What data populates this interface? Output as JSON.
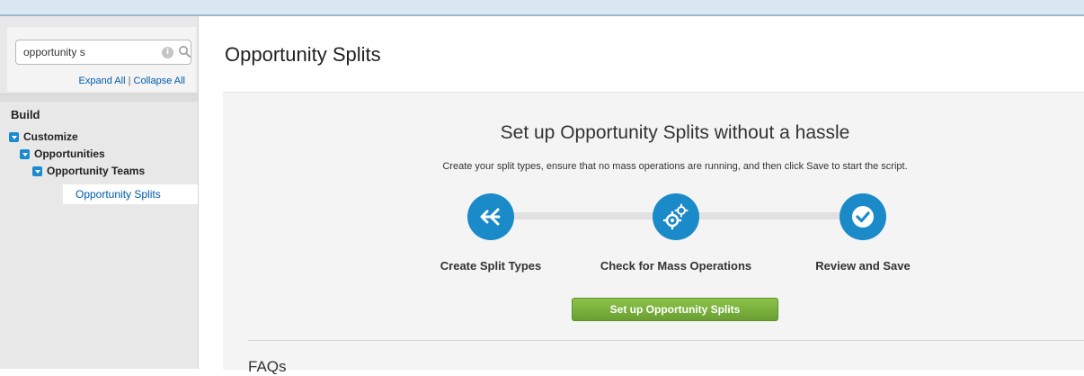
{
  "search": {
    "value": "opportunity s",
    "clear_glyph": "i",
    "icon": "search-icon"
  },
  "sidebar": {
    "expand_all": "Expand All",
    "separator": "|",
    "collapse_all": "Collapse All",
    "section_heading": "Build",
    "tree": [
      {
        "label": "Customize",
        "icon": "expand-toggle-icon"
      },
      {
        "label": "Opportunities",
        "icon": "expand-toggle-icon"
      },
      {
        "label": "Opportunity Teams",
        "icon": "expand-toggle-icon"
      }
    ],
    "selected_item": "Opportunity Splits"
  },
  "main": {
    "page_title": "Opportunity Splits",
    "panel": {
      "heading": "Set up Opportunity Splits without a hassle",
      "subtitle": "Create your split types, ensure that no mass operations are running, and then click Save to start the script.",
      "steps": [
        {
          "label": "Create Split Types",
          "icon": "split-arrows-icon"
        },
        {
          "label": "Check for Mass Operations",
          "icon": "gears-icon"
        },
        {
          "label": "Review and Save",
          "icon": "checkmark-icon"
        }
      ],
      "button_label": "Set up Opportunity Splits",
      "faq_heading": "FAQs"
    }
  },
  "colors": {
    "step_circle": "#1a8ac8",
    "button_green": "#7cb342",
    "link_blue": "#015ba7",
    "tree_toggle": "#1b8bd1"
  }
}
